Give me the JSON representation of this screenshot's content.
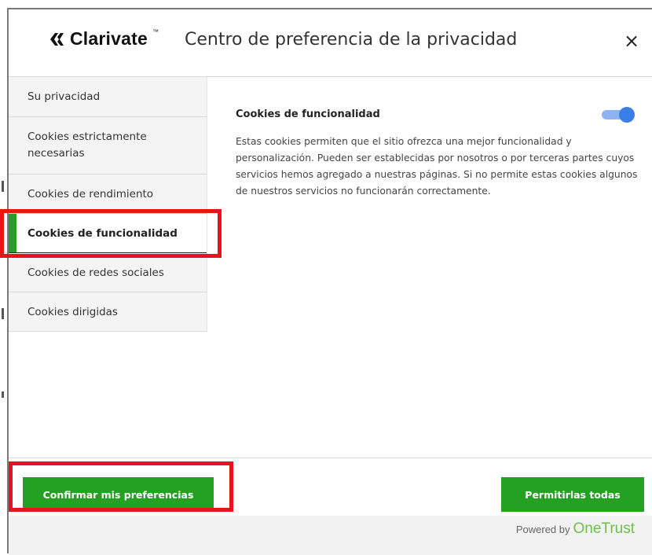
{
  "header": {
    "logo_text": "Clarivate",
    "logo_tm": "™",
    "title": "Centro de preferencia de la privacidad",
    "close_label": "×"
  },
  "sidebar": {
    "items": [
      {
        "label": "Su privacidad",
        "active": false
      },
      {
        "label": "Cookies estrictamente necesarias",
        "active": false
      },
      {
        "label": "Cookies de rendimiento",
        "active": false
      },
      {
        "label": "Cookies de funcionalidad",
        "active": true
      },
      {
        "label": "Cookies de redes sociales",
        "active": false
      },
      {
        "label": "Cookies dirigidas",
        "active": false
      }
    ]
  },
  "content": {
    "section_title": "Cookies de funcionalidad",
    "toggle_on": true,
    "description": "Estas cookies permiten que el sitio ofrezca una mejor funcionalidad y personalización. Pueden ser establecidas por nosotros o por terceras partes cuyos servicios hemos agregado a nuestras páginas. Si no permite estas cookies algunos de nuestros servicios no funcionarán correctamente."
  },
  "footer": {
    "confirm_label": "Confirmar mis preferencias",
    "allow_all_label": "Permitirlas todas",
    "powered_by": "Powered by",
    "onetrust": "OneTrust"
  },
  "colors": {
    "accent_green": "#24a022",
    "toggle_blue": "#3b7ee8",
    "onetrust_green": "#6cc04a",
    "highlight_red": "#e8141c"
  },
  "icons": [
    "clarivate-logo-icon",
    "close-icon",
    "toggle-switch"
  ]
}
